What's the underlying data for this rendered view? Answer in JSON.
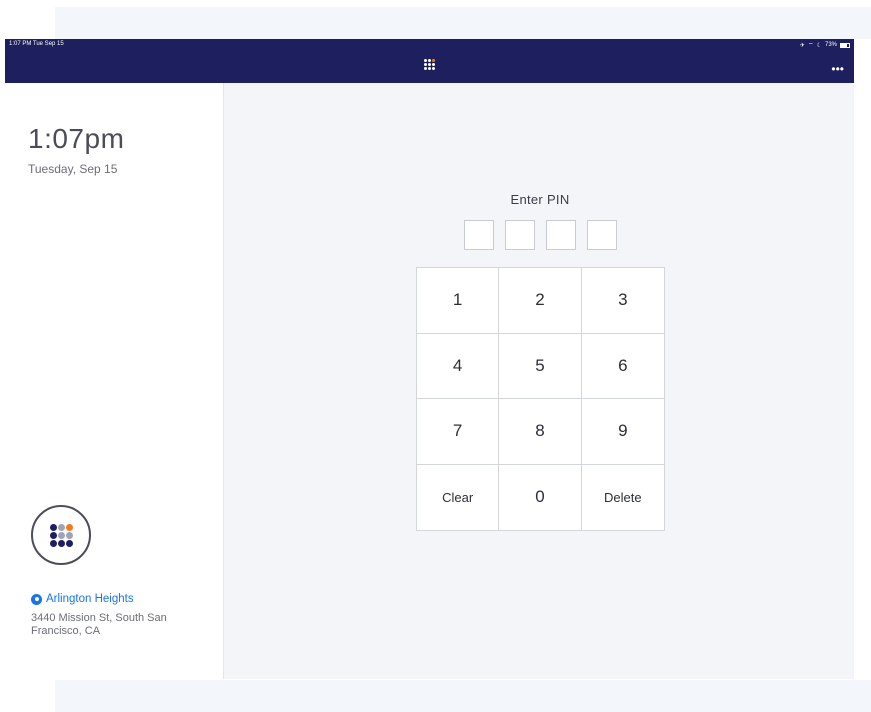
{
  "status_bar": {
    "time": "1:07 PM  Tue Sep 15",
    "battery": "73%",
    "battery_level": 0.73
  },
  "sidebar": {
    "clock": "1:07pm",
    "date": "Tuesday, Sep 15",
    "location_name": "Arlington Heights",
    "address": "3440 Mission St, South San Francisco, CA"
  },
  "pin": {
    "title": "Enter PIN",
    "digits_entered": 0
  },
  "keypad": {
    "k1": "1",
    "k2": "2",
    "k3": "3",
    "k4": "4",
    "k5": "5",
    "k6": "6",
    "k7": "7",
    "k8": "8",
    "k9": "9",
    "clear": "Clear",
    "k0": "0",
    "delete": "Delete"
  },
  "colors": {
    "header_bg": "#1d1f5e",
    "accent_link": "#1a73e8",
    "logo_navy": "#1d1f5e",
    "logo_orange": "#f27a1a",
    "logo_gray": "#9fa3b8"
  },
  "icons": {
    "brand": "brand-grid-icon",
    "more": "more-icon",
    "location": "location-pin-icon",
    "airplane": "airplane-icon",
    "wifi": "wifi-icon",
    "moon": "moon-icon",
    "battery": "battery-icon"
  }
}
